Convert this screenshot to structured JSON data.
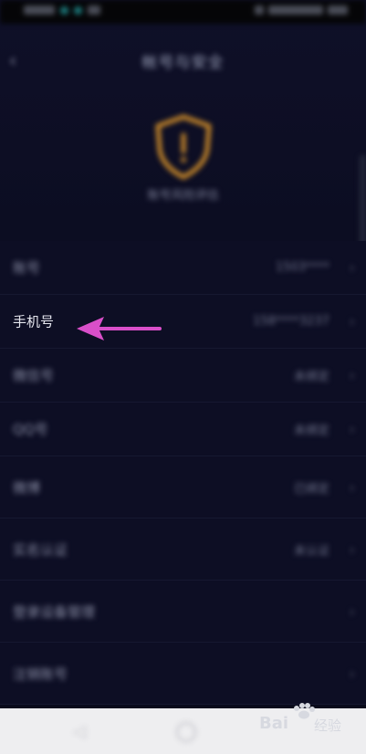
{
  "header": {
    "title": "帐号与安全"
  },
  "shield": {
    "caption": "账号风险评估"
  },
  "list": {
    "rows": [
      {
        "label": "账号",
        "value": "1503****",
        "sharp": false
      },
      {
        "label": "手机号",
        "value": "158****3237",
        "sharp": true
      },
      {
        "label": "微信号",
        "value": "未绑定",
        "sharp": false
      },
      {
        "label": "QQ号",
        "value": "未绑定",
        "sharp": false
      },
      {
        "label": "微博",
        "value": "已绑定",
        "sharp": false
      },
      {
        "label": "实名认证",
        "value": "未认证",
        "sharp": false
      },
      {
        "label": "登录设备管理",
        "value": "",
        "sharp": false
      },
      {
        "label": "注销账号",
        "value": "",
        "sharp": false
      }
    ]
  },
  "watermark": {
    "brand": "Bai",
    "suffix": "经验"
  },
  "colors": {
    "accent_arrow": "#d94fc9",
    "shield": "#c8882a"
  }
}
